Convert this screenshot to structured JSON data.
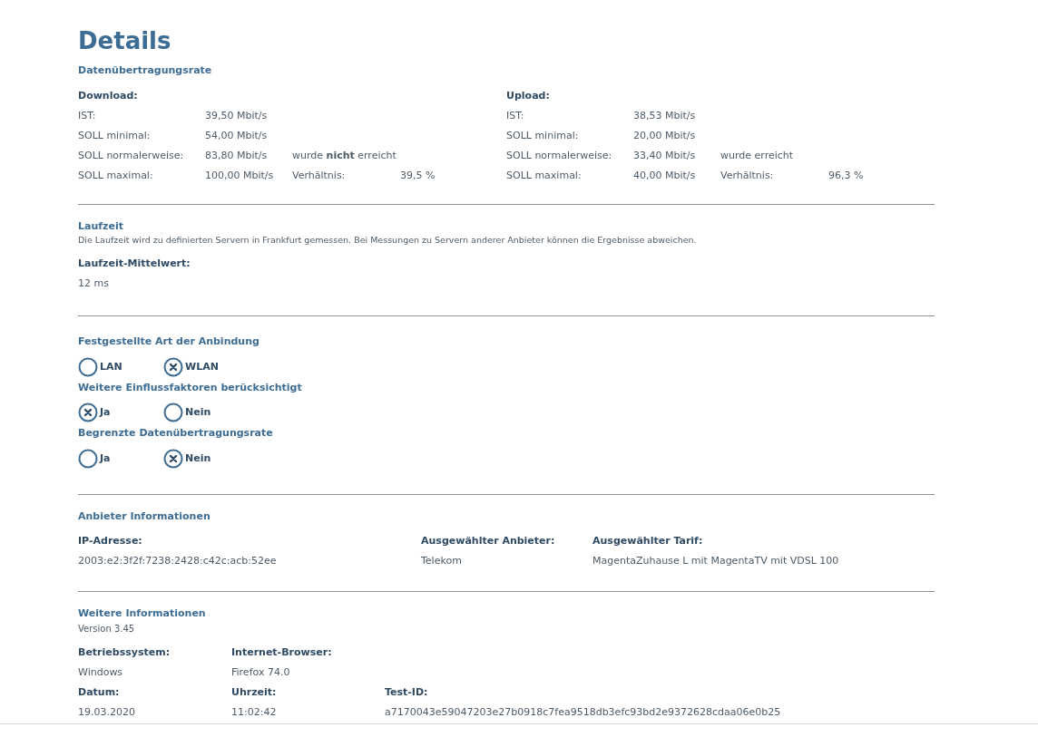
{
  "title": "Details",
  "rate": {
    "heading": "Datenübertragungsrate",
    "groups": [
      {
        "label": "Download:",
        "rows": [
          {
            "label": "IST:",
            "value": "39,50 Mbit/s"
          },
          {
            "label": "SOLL minimal:",
            "value": "54,00 Mbit/s"
          },
          {
            "label": "SOLL normalerweise:",
            "value": "83,80 Mbit/s",
            "note": "wurde **nicht** erreicht"
          },
          {
            "label": "SOLL maximal:",
            "value": "100,00 Mbit/s",
            "note": "Verhältnis:",
            "note_value": "39,5 %"
          }
        ]
      },
      {
        "label": "Upload:",
        "rows": [
          {
            "label": "IST:",
            "value": "38,53 Mbit/s"
          },
          {
            "label": "SOLL minimal:",
            "value": "20,00 Mbit/s"
          },
          {
            "label": "SOLL normalerweise:",
            "value": "33,40 Mbit/s",
            "note": "wurde erreicht"
          },
          {
            "label": "SOLL maximal:",
            "value": "40,00 Mbit/s",
            "note": "Verhältnis:",
            "note_value": "96,3 %"
          }
        ]
      }
    ]
  },
  "latency": {
    "heading": "Laufzeit",
    "description": "Die Laufzeit wird zu definierten Servern in Frankfurt gemessen. Bei Messungen zu Servern anderer Anbieter können die Ergebnisse abweichen.",
    "label": "Laufzeit-Mittelwert:",
    "value": "12 ms"
  },
  "radio_groups": [
    {
      "heading": "Festgestellte Art der Anbindung",
      "options": [
        {
          "label": "LAN",
          "selected": false
        },
        {
          "label": "WLAN",
          "selected": true
        }
      ]
    },
    {
      "heading": "Weitere Einflussfaktoren berücksichtigt",
      "options": [
        {
          "label": "Ja",
          "selected": true
        },
        {
          "label": "Nein",
          "selected": false
        }
      ]
    },
    {
      "heading": "Begrenzte Datenübertragungsrate",
      "options": [
        {
          "label": "Ja",
          "selected": false
        },
        {
          "label": "Nein",
          "selected": true
        }
      ]
    }
  ],
  "provider": {
    "heading": "Anbieter Informationen",
    "fields": [
      {
        "label": "IP-Adresse:",
        "value": "2003:e2:3f2f:7238:2428:c42c:acb:52ee"
      },
      {
        "label": "Ausgewählter Anbieter:",
        "value": "Telekom"
      },
      {
        "label": "Ausgewählter Tarif:",
        "value": "MagentaZuhause L mit MagentaTV mit VDSL 100"
      }
    ]
  },
  "more": {
    "heading": "Weitere Informationen",
    "version": "Version 3.45",
    "rows": [
      [
        {
          "label": "Betriebssystem:",
          "value": "Windows"
        },
        {
          "label": "Internet-Browser:",
          "value": "Firefox 74.0"
        }
      ],
      [
        {
          "label": "Datum:",
          "value": "19.03.2020"
        },
        {
          "label": "Uhrzeit:",
          "value": "11:02:42"
        },
        {
          "label": "Test-ID:",
          "value": "a7170043e59047203e27b0918c7fea9518db3efc93bd2e9372628cdaa06e0b25"
        }
      ]
    ]
  }
}
